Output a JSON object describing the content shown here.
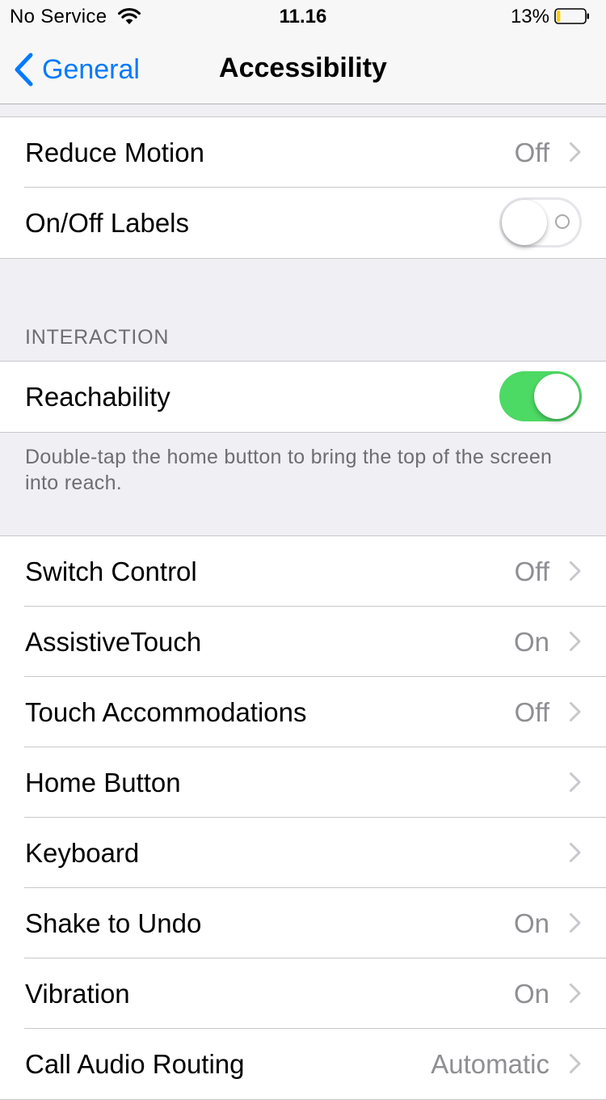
{
  "status_bar": {
    "carrier": "No Service",
    "time": "11.16",
    "battery_percent": "13%",
    "battery_level": 0.13,
    "battery_color": "#ffcc00"
  },
  "nav": {
    "back_label": "General",
    "title": "Accessibility"
  },
  "colors": {
    "accent": "#007aff",
    "toggle_on": "#4cd964"
  },
  "top_group": {
    "rows": [
      {
        "label": "Reduce Motion",
        "value": "Off",
        "accessory": "chevron-right-icon"
      },
      {
        "label": "On/Off Labels",
        "toggle_on": false
      }
    ]
  },
  "interaction": {
    "header": "INTERACTION",
    "reachability": {
      "label": "Reachability",
      "toggle_on": true
    },
    "footer": "Double-tap the home button to bring the top of the screen into reach."
  },
  "list": {
    "rows": [
      {
        "label": "Switch Control",
        "value": "Off",
        "accessory": "chevron-right-icon"
      },
      {
        "label": "AssistiveTouch",
        "value": "On",
        "accessory": "chevron-right-icon"
      },
      {
        "label": "Touch Accommodations",
        "value": "Off",
        "accessory": "chevron-right-icon"
      },
      {
        "label": "Home Button",
        "value": "",
        "accessory": "chevron-right-icon"
      },
      {
        "label": "Keyboard",
        "value": "",
        "accessory": "chevron-right-icon"
      },
      {
        "label": "Shake to Undo",
        "value": "On",
        "accessory": "chevron-right-icon"
      },
      {
        "label": "Vibration",
        "value": "On",
        "accessory": "chevron-right-icon"
      },
      {
        "label": "Call Audio Routing",
        "value": "Automatic",
        "accessory": "chevron-right-icon"
      }
    ]
  }
}
